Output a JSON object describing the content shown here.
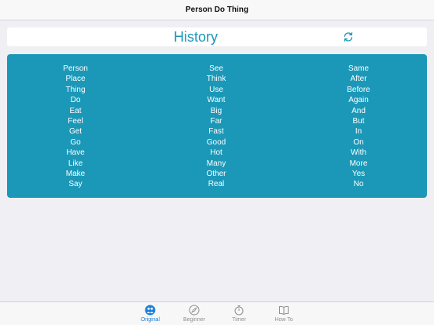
{
  "navbar": {
    "title": "Person Do Thing"
  },
  "history": {
    "title": "History",
    "refresh_icon": "refresh-icon"
  },
  "words": {
    "column1": [
      "Person",
      "Place",
      "Thing",
      "Do",
      "Eat",
      "Feel",
      "Get",
      "Go",
      "Have",
      "Like",
      "Make",
      "Say"
    ],
    "column2": [
      "See",
      "Think",
      "Use",
      "Want",
      "Big",
      "Far",
      "Fast",
      "Good",
      "Hot",
      "Many",
      "Other",
      "Real"
    ],
    "column3": [
      "Same",
      "After",
      "Before",
      "Again",
      "And",
      "But",
      "In",
      "On",
      "With",
      "More",
      "Yes",
      "No"
    ]
  },
  "tabs": [
    {
      "label": "Original",
      "icon": "people-icon",
      "active": true
    },
    {
      "label": "Beginner",
      "icon": "compass-icon",
      "active": false
    },
    {
      "label": "Timer",
      "icon": "stopwatch-icon",
      "active": false
    },
    {
      "label": "How To",
      "icon": "book-icon",
      "active": false
    }
  ],
  "colors": {
    "accent": "#1b95b9",
    "panel": "#1b98b8",
    "tab_active": "#1b7fd6",
    "tab_inactive": "#8e8e93",
    "background": "#efeff4"
  }
}
